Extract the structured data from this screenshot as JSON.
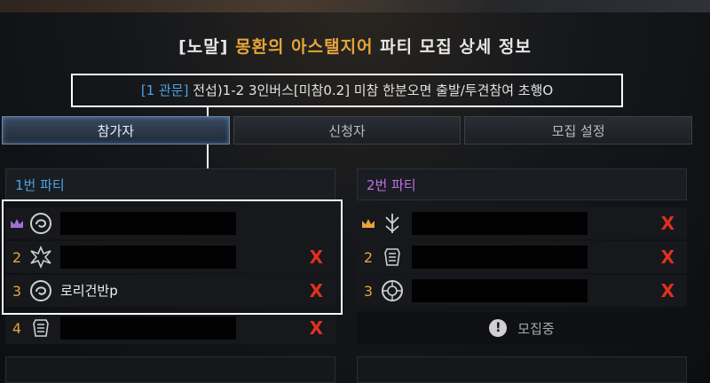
{
  "header": {
    "prefix": "[노말]",
    "raid_name": "몽환의 아스탤지어",
    "suffix": "파티 모집 상세 정보"
  },
  "recruit": {
    "category": "[1 관문]",
    "description": "전섭)1-2 3인버스[미참0.2] 미참 한분오면 출발/투견참여 초행O"
  },
  "tabs": [
    {
      "label": "참가자",
      "active": true
    },
    {
      "label": "신청자",
      "active": false
    },
    {
      "label": "모집 설정",
      "active": false
    }
  ],
  "party1": {
    "title": "1번 파티",
    "members": [
      {
        "slot": "crown",
        "emblem": "bard-emblem-icon",
        "name": "",
        "kick": ""
      },
      {
        "slot": "2",
        "emblem": "berserker-emblem-icon",
        "name": "",
        "kick": "X"
      },
      {
        "slot": "3",
        "emblem": "bard-emblem-icon",
        "name": "로리건반p",
        "kick": "X"
      },
      {
        "slot": "4",
        "emblem": "warlord-emblem-icon",
        "name": "",
        "kick": "X"
      }
    ]
  },
  "party2": {
    "title": "2번 파티",
    "members": [
      {
        "slot": "crown",
        "emblem": "destroyer-emblem-icon",
        "name": "",
        "kick": "X"
      },
      {
        "slot": "2",
        "emblem": "warlord-emblem-icon",
        "name": "",
        "kick": "X"
      },
      {
        "slot": "3",
        "emblem": "holyknight-emblem-icon",
        "name": "",
        "kick": "X"
      }
    ],
    "recruiting_label": "모집중"
  },
  "colors": {
    "gold": "#e6a43a",
    "party1": "#4ea3e6",
    "party2": "#c070e6",
    "kick": "#e03020"
  }
}
